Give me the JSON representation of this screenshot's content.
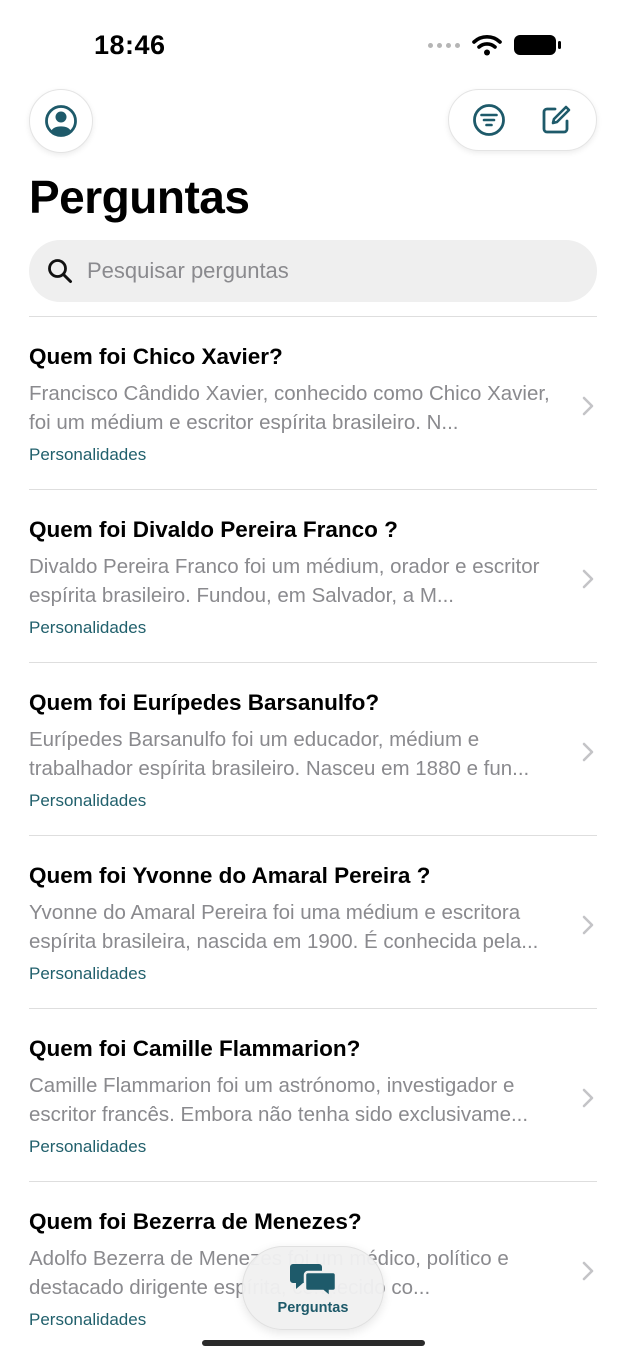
{
  "status_bar": {
    "time": "18:46"
  },
  "header": {
    "title": "Perguntas"
  },
  "search": {
    "placeholder": "Pesquisar perguntas"
  },
  "colors": {
    "accent": "#1e5a6a",
    "tag": "#21606c",
    "secondary_text": "#8a8a8e"
  },
  "questions": [
    {
      "title": "Quem foi Chico Xavier?",
      "excerpt": "Francisco Cândido Xavier, conhecido como Chico Xavier, foi um médium e escritor espírita brasileiro. N...",
      "tag": "Personalidades"
    },
    {
      "title": "Quem foi Divaldo Pereira Franco ?",
      "excerpt": "Divaldo Pereira Franco foi um médium, orador e escritor espírita brasileiro. Fundou, em Salvador, a M...",
      "tag": "Personalidades"
    },
    {
      "title": "Quem foi Eurípedes Barsanulfo?",
      "excerpt": "Eurípedes Barsanulfo foi um educador, médium e trabalhador espírita brasileiro. Nasceu em 1880 e fun...",
      "tag": "Personalidades"
    },
    {
      "title": "Quem foi Yvonne do Amaral Pereira ?",
      "excerpt": "Yvonne do Amaral Pereira foi uma médium e escritora espírita brasileira, nascida em 1900. É conhecida pela...",
      "tag": "Personalidades"
    },
    {
      "title": "Quem foi Camille Flammarion?",
      "excerpt": "Camille Flammarion foi um astrónomo, investigador e escritor francês. Embora não tenha sido exclusivame...",
      "tag": "Personalidades"
    },
    {
      "title": "Quem foi Bezerra de Menezes?",
      "excerpt": "Adolfo Bezerra de Menezes foi um médico, político e destacado dirigente espírita, conhecido co...",
      "tag": "Personalidades"
    }
  ],
  "tab_bar": {
    "active_tab_label": "Perguntas",
    "active_tab_icon": "chat-bubbles-icon"
  }
}
